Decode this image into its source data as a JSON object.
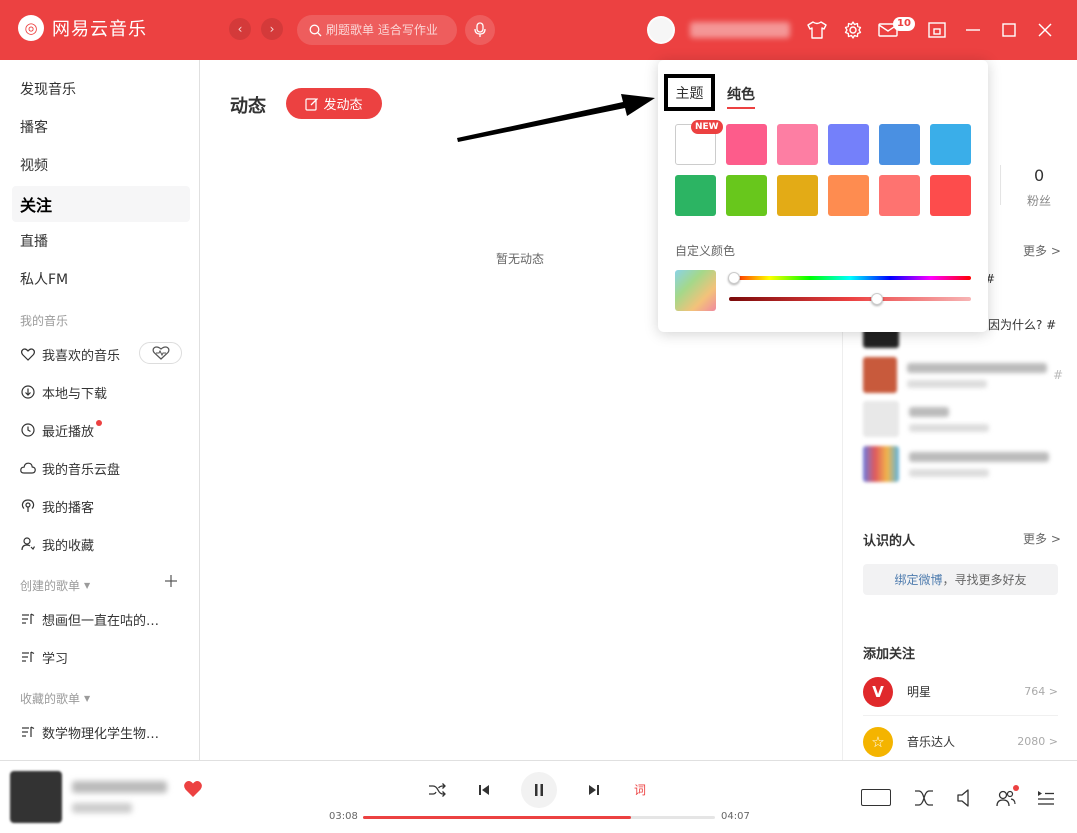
{
  "app": {
    "name": "网易云音乐",
    "logo_glyph": "◎"
  },
  "topbar": {
    "search_placeholder": "刷题歌单 适合写作业",
    "mail_count": "10"
  },
  "sidebar": {
    "main_items": [
      {
        "label": "发现音乐"
      },
      {
        "label": "播客"
      },
      {
        "label": "视频"
      },
      {
        "label": "关注"
      },
      {
        "label": "直播"
      },
      {
        "label": "私人FM"
      }
    ],
    "my_music_header": "我的音乐",
    "my_music": [
      {
        "label": "我喜欢的音乐",
        "icon": "heart-icon"
      },
      {
        "label": "本地与下载",
        "icon": "download-icon"
      },
      {
        "label": "最近播放",
        "icon": "clock-icon"
      },
      {
        "label": "我的音乐云盘",
        "icon": "cloud-icon"
      },
      {
        "label": "我的播客",
        "icon": "podcast-icon"
      },
      {
        "label": "我的收藏",
        "icon": "collect-icon"
      }
    ],
    "created_header": "创建的歌单",
    "created": [
      {
        "label": "想画但一直在咕的…"
      },
      {
        "label": "学习"
      }
    ],
    "collected_header": "收藏的歌单",
    "collected": [
      {
        "label": "数学物理化学生物…"
      }
    ]
  },
  "main": {
    "title": "动态",
    "post_button": "发动态",
    "empty_text": "暂无动态"
  },
  "right_panel": {
    "fans_count": "0",
    "fans_label": "粉丝",
    "more": "更多 >",
    "topic_fragments": [
      "#",
      "因为什么? #",
      "#"
    ],
    "people_title": "认识的人",
    "weibo_link": "绑定微博",
    "weibo_rest": "，寻找更多好友",
    "add_follow_title": "添加关注",
    "follow_items": [
      {
        "name": "明星",
        "count": "764 >",
        "avatar": "V",
        "color": "#e0292b"
      },
      {
        "name": "音乐达人",
        "count": "2080 >",
        "avatar": "☆",
        "color": "#f4b400"
      }
    ]
  },
  "theme_popup": {
    "tab_theme": "主题",
    "tab_solid": "纯色",
    "new_badge": "NEW",
    "swatches_row1": [
      "#ffffff",
      "#fd5c8b",
      "#fd7ea3",
      "#7480fa",
      "#4a90e2",
      "#3aaee9"
    ],
    "swatches_row2": [
      "#2cb463",
      "#68c71c",
      "#e3ab16",
      "#fe8c50",
      "#fe7370",
      "#fd4c4c"
    ],
    "custom_color_label": "自定义颜色",
    "hue_slider_value": 0.02,
    "lightness_slider_value": 0.61
  },
  "player": {
    "time_current": "03:08",
    "time_total": "04:07",
    "progress": 0.76,
    "lyric_label": "词"
  },
  "colors": {
    "accent": "#ec4141"
  }
}
